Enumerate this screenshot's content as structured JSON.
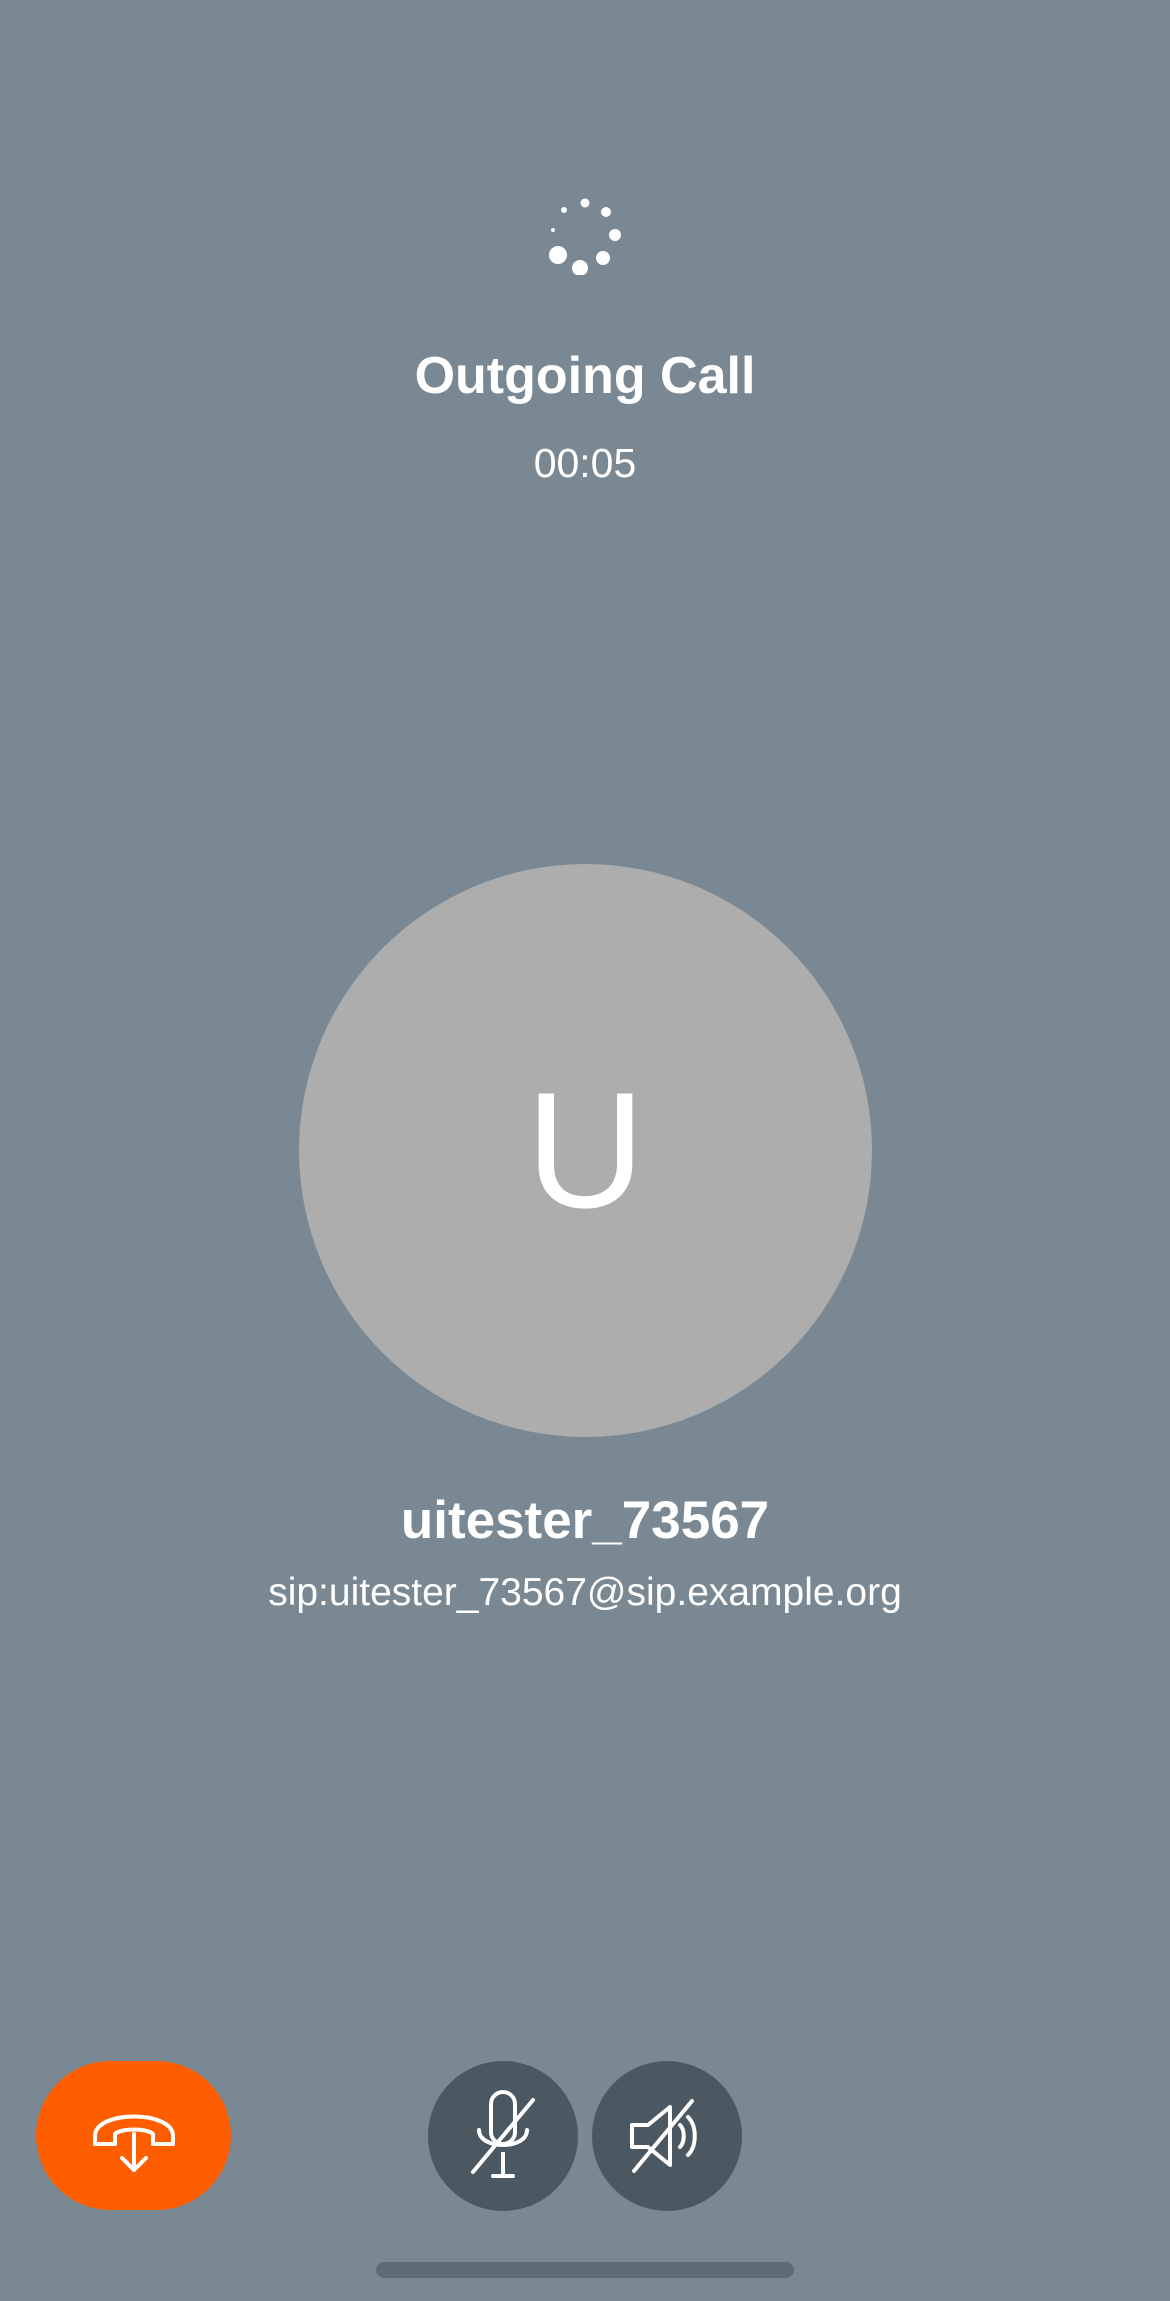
{
  "call": {
    "status": "Outgoing Call",
    "duration": "00:05"
  },
  "contact": {
    "initial": "U",
    "name": "uitester_73567",
    "address": "sip:uitester_73567@sip.example.org"
  },
  "controls": {
    "hangup_icon": "hang-up-icon",
    "mic_icon": "microphone-off-icon",
    "speaker_icon": "speaker-off-icon",
    "hangup_color": "#ff5e00",
    "control_color": "#4b5761"
  },
  "colors": {
    "background": "#798892",
    "avatar": "#adadad"
  }
}
